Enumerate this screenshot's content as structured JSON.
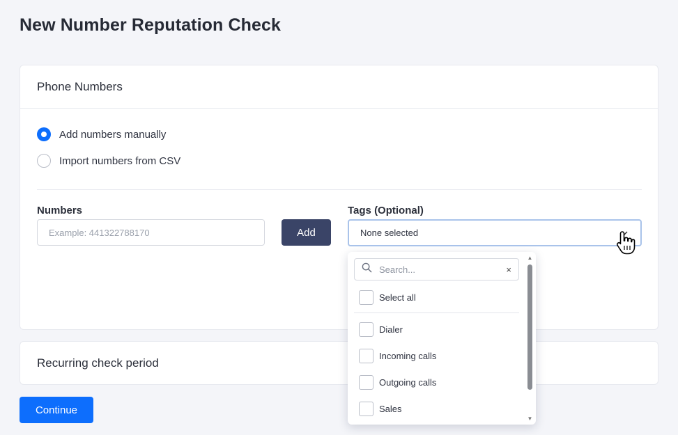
{
  "page": {
    "title": "New Number Reputation Check"
  },
  "phone_numbers": {
    "header": "Phone Numbers",
    "radio_options": [
      {
        "label": "Add numbers manually",
        "checked": true
      },
      {
        "label": "Import numbers from CSV",
        "checked": false
      }
    ],
    "numbers_label": "Numbers",
    "numbers_input": {
      "value": "",
      "placeholder": "Example: 441322788170"
    },
    "add_button_label": "Add",
    "tags_label": "Tags (Optional)",
    "tags_select_value": "None selected"
  },
  "tags_dropdown": {
    "search_placeholder": "Search...",
    "clear_glyph": "×",
    "select_all_label": "Select all",
    "options": [
      {
        "label": "Dialer",
        "checked": false
      },
      {
        "label": "Incoming calls",
        "checked": false
      },
      {
        "label": "Outgoing calls",
        "checked": false
      },
      {
        "label": "Sales",
        "checked": false
      }
    ]
  },
  "recurring": {
    "header": "Recurring check period"
  },
  "footer": {
    "continue_label": "Continue"
  },
  "colors": {
    "primary": "#0d6efd",
    "add_button": "#3a4467",
    "page_background": "#f4f5f9"
  },
  "icons": {
    "search": "search-icon",
    "clear": "close-icon",
    "dropdown": "chevron-down-icon",
    "cursor": "hand-pointer-icon"
  }
}
